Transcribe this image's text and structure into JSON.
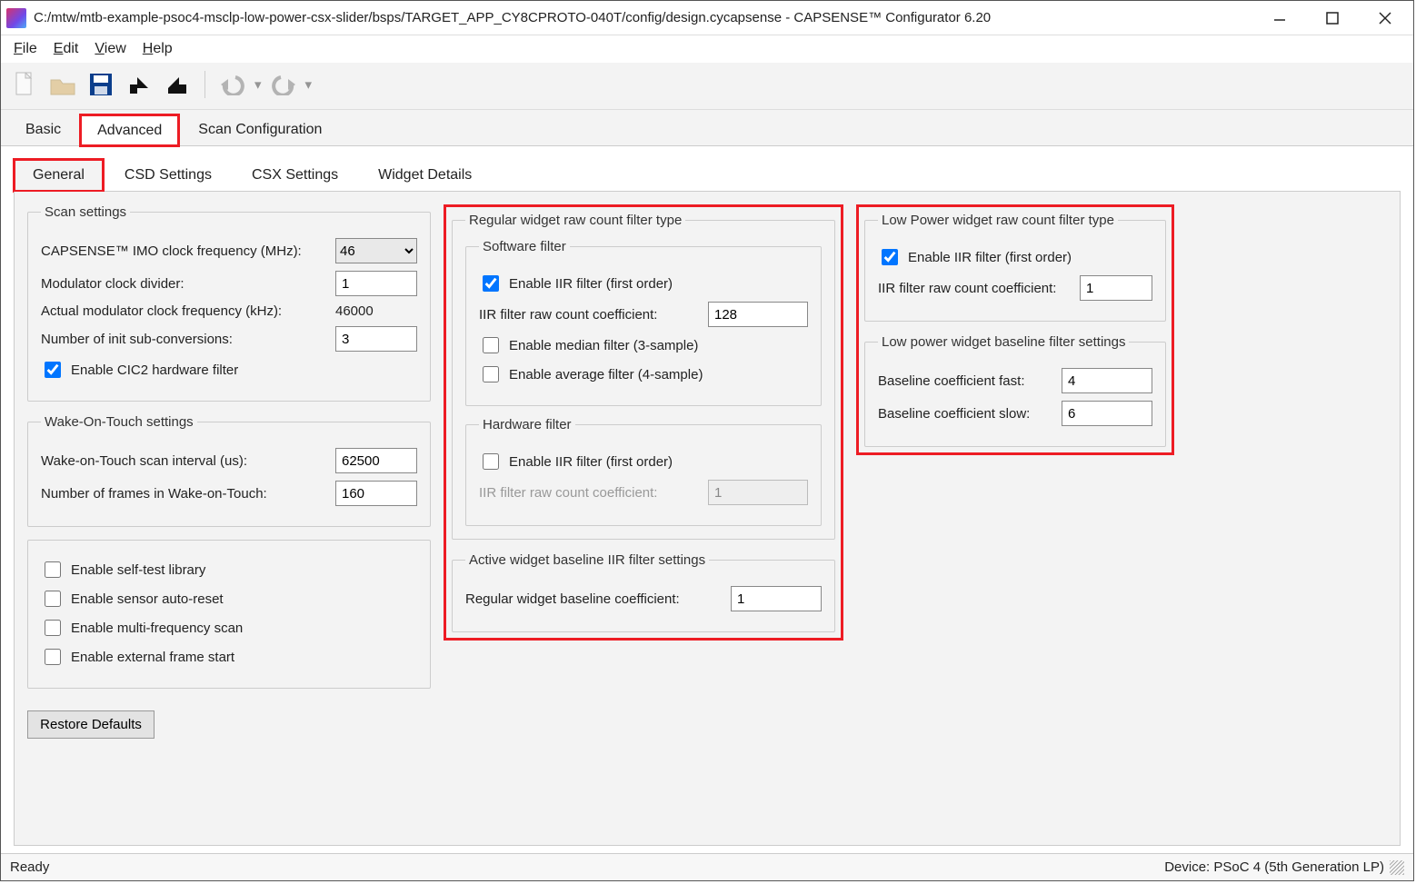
{
  "window": {
    "title": "C:/mtw/mtb-example-psoc4-msclp-low-power-csx-slider/bsps/TARGET_APP_CY8CPROTO-040T/config/design.cycapsense - CAPSENSE™ Configurator 6.20"
  },
  "menu": {
    "file": "File",
    "edit": "Edit",
    "view": "View",
    "help": "Help"
  },
  "main_tabs": {
    "basic": "Basic",
    "advanced": "Advanced",
    "scan": "Scan Configuration"
  },
  "sub_tabs": {
    "general": "General",
    "csd": "CSD Settings",
    "csx": "CSX Settings",
    "widget": "Widget Details"
  },
  "scan": {
    "legend": "Scan settings",
    "imo_label": "CAPSENSE™ IMO clock frequency (MHz):",
    "imo_value": "46",
    "mod_div_label": "Modulator clock divider:",
    "mod_div_value": "1",
    "actual_label": "Actual modulator clock frequency (kHz):",
    "actual_value": "46000",
    "init_sub_label": "Number of init sub-conversions:",
    "init_sub_value": "3",
    "cic2_label": "Enable CIC2 hardware filter"
  },
  "wot": {
    "legend": "Wake-On-Touch settings",
    "interval_label": "Wake-on-Touch scan interval (us):",
    "interval_value": "62500",
    "frames_label": "Number of frames in Wake-on-Touch:",
    "frames_value": "160"
  },
  "opts": {
    "selftest": "Enable self-test library",
    "autoreset": "Enable sensor auto-reset",
    "multifreq": "Enable multi-frequency scan",
    "extframe": "Enable external frame start"
  },
  "restore": "Restore Defaults",
  "reg_filter": {
    "legend": "Regular widget raw count filter type",
    "sw_legend": "Software filter",
    "sw_iir_label": "Enable IIR filter (first order)",
    "sw_iir_coef_label": "IIR filter raw count coefficient:",
    "sw_iir_coef_value": "128",
    "median_label": "Enable median filter (3-sample)",
    "avg_label": "Enable average filter (4-sample)",
    "hw_legend": "Hardware filter",
    "hw_iir_label": "Enable IIR filter (first order)",
    "hw_iir_coef_label": "IIR filter raw count coefficient:",
    "hw_iir_coef_value": "1"
  },
  "active_baseline": {
    "legend": "Active widget baseline IIR filter settings",
    "reg_coef_label": "Regular widget baseline coefficient:",
    "reg_coef_value": "1"
  },
  "lp_filter": {
    "legend": "Low Power widget raw count filter type",
    "iir_label": "Enable IIR filter (first order)",
    "coef_label": "IIR filter raw count coefficient:",
    "coef_value": "1"
  },
  "lp_baseline": {
    "legend": "Low power widget baseline filter settings",
    "fast_label": "Baseline coefficient fast:",
    "fast_value": "4",
    "slow_label": "Baseline coefficient slow:",
    "slow_value": "6"
  },
  "status": {
    "left": "Ready",
    "right": "Device: PSoC 4 (5th Generation LP)"
  }
}
